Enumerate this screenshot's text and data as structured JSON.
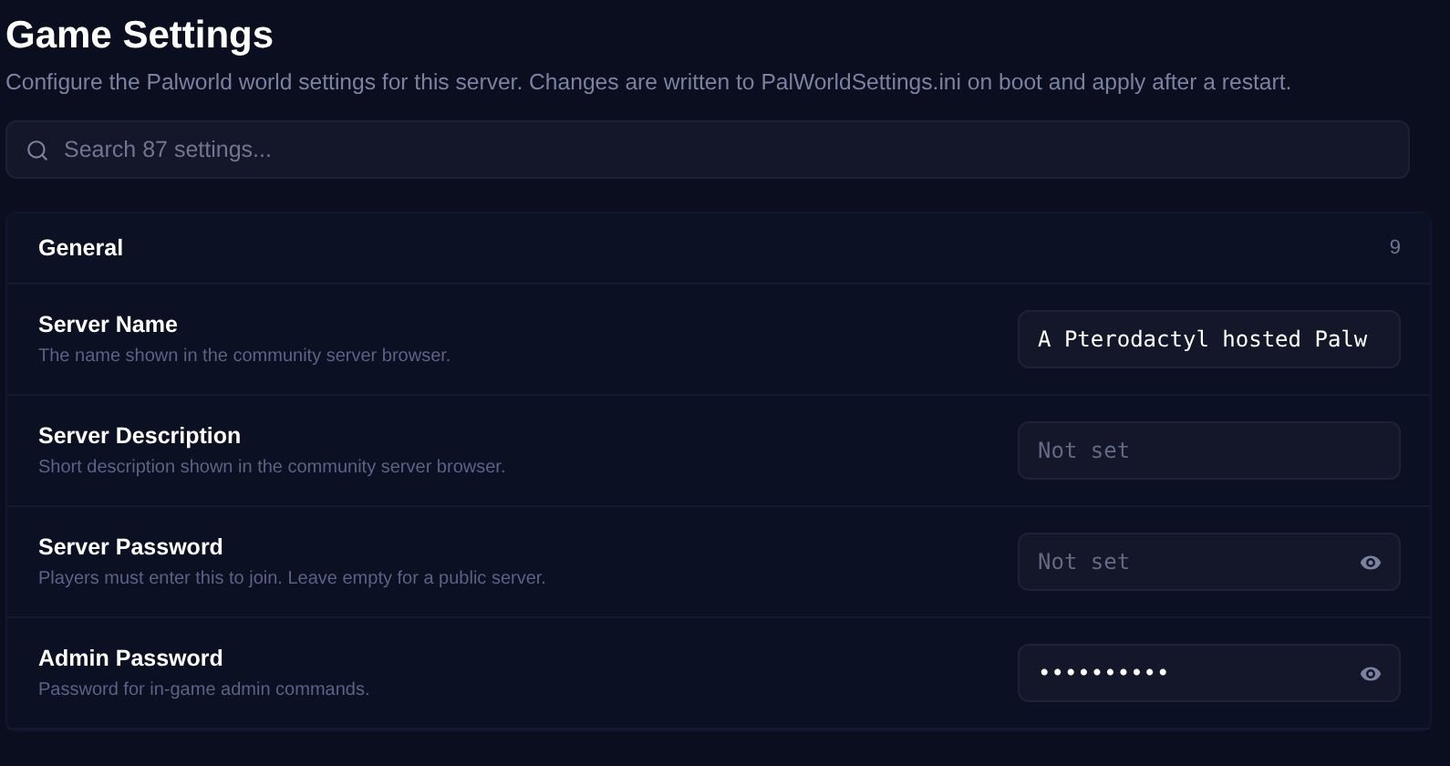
{
  "title": "Game Settings",
  "subtitle": "Configure the Palworld world settings for this server. Changes are written to PalWorldSettings.ini on boot and apply after a restart.",
  "search": {
    "placeholder": "Search 87 settings..."
  },
  "section": {
    "title": "General",
    "count": "9",
    "settings": [
      {
        "kind": "text",
        "label": "Server Name",
        "description": "The name shown in the community server browser.",
        "value": "A Pterodactyl hosted Palw"
      },
      {
        "kind": "text",
        "label": "Server Description",
        "description": "Short description shown in the community server browser.",
        "placeholder": "Not set"
      },
      {
        "kind": "password",
        "label": "Server Password",
        "description": "Players must enter this to join. Leave empty for a public server.",
        "placeholder": "Not set"
      },
      {
        "kind": "password",
        "label": "Admin Password",
        "description": "Password for in-game admin commands.",
        "value": "••••••••••"
      }
    ]
  }
}
